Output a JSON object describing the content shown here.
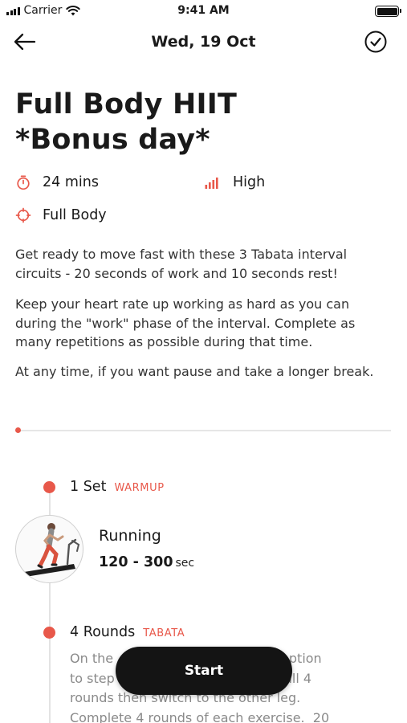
{
  "status_bar": {
    "carrier": "Carrier",
    "time": "9:41 AM"
  },
  "nav": {
    "title": "Wed, 19 Oct",
    "back_icon": "arrow-left-icon",
    "complete_icon": "check-circle-icon"
  },
  "workout": {
    "title_line_1": "Full Body HIIT",
    "title_line_2": "*Bonus day*",
    "duration": "24 mins",
    "intensity": "High",
    "focus": "Full Body",
    "description": [
      "Get ready to move fast with these 3 Tabata interval circuits - 20 seconds of work and 10 seconds rest!",
      "Keep your heart rate up working as hard as you can during the \"work\" phase of the interval. Complete as many repetitions as possible during that time.",
      "At any time, if you want pause and take a longer break."
    ]
  },
  "sets": [
    {
      "count": "1 Set",
      "type": "WARMUP",
      "exercise": {
        "name": "Running",
        "range": "120 - 300",
        "unit": "sec"
      }
    },
    {
      "count": "4 Rounds",
      "type": "TABATA",
      "note_lines": [
        "On the                                e the option",
        "to step                              or the full 4",
        "rounds then switch to the other leg.",
        "Complete 4 rounds of each exercise.  20"
      ]
    }
  ],
  "actions": {
    "start_label": "Start"
  },
  "colors": {
    "accent": "#e8584a",
    "button": "#141414"
  }
}
